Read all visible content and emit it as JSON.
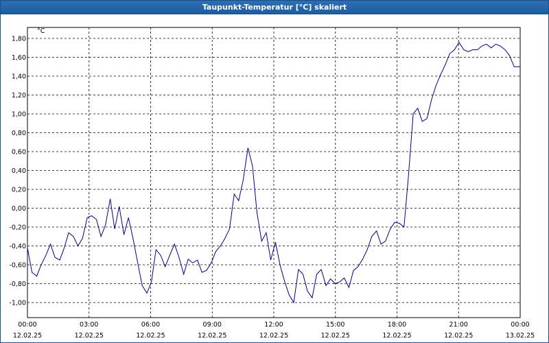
{
  "window": {
    "title": "Taupunkt-Temperatur [°C] skaliert"
  },
  "chart_data": {
    "type": "line",
    "title": "Taupunkt-Temperatur [°C] skaliert",
    "ylabel": "°C",
    "xlabel": "",
    "ylim": [
      -1.1,
      1.9
    ],
    "xlim": [
      "12.02.25 00:00",
      "13.02.25 00:00"
    ],
    "grid": true,
    "line_color": "#00008b",
    "grid_color": "#000000",
    "y_ticks": [
      "1,80",
      "1,60",
      "1,40",
      "1,20",
      "1,00",
      "0,80",
      "0,60",
      "0,40",
      "0,20",
      "0,00",
      "-0,20",
      "-0,40",
      "-0,60",
      "-0,80",
      "-1,00"
    ],
    "x_ticks": [
      {
        "time": "00:00",
        "date": "12.02.25"
      },
      {
        "time": "03:00",
        "date": "12.02.25"
      },
      {
        "time": "06:00",
        "date": "12.02.25"
      },
      {
        "time": "09:00",
        "date": "12.02.25"
      },
      {
        "time": "12:00",
        "date": "12.02.25"
      },
      {
        "time": "15:00",
        "date": "12.02.25"
      },
      {
        "time": "18:00",
        "date": "12.02.25"
      },
      {
        "time": "21:00",
        "date": "12.02.25"
      },
      {
        "time": "00:00",
        "date": "13.02.25"
      }
    ],
    "series": [
      {
        "x_hours": [
          0,
          0.22,
          0.45,
          0.67,
          0.9,
          1.12,
          1.34,
          1.57,
          1.79,
          2.01,
          2.24,
          2.46,
          2.68,
          2.91,
          3.13,
          3.36,
          3.58,
          3.8,
          4.03,
          4.25,
          4.47,
          4.7,
          4.92,
          5.14,
          5.37,
          5.59,
          5.82,
          6.04,
          6.26,
          6.49,
          6.71,
          6.93,
          7.16,
          7.38,
          7.61,
          7.83,
          8.05,
          8.28,
          8.5,
          8.72,
          8.95,
          9.17,
          9.4,
          9.62,
          9.84,
          10.07,
          10.29,
          10.51,
          10.74,
          10.96,
          11.18,
          11.41,
          11.63,
          11.85,
          12.08,
          12.3,
          12.53,
          12.75,
          12.97,
          13.2,
          13.42,
          13.64,
          13.87,
          14.09,
          14.31,
          14.54,
          14.76,
          14.98,
          15.21,
          15.43,
          15.66,
          15.88,
          16.1,
          16.33,
          16.55,
          16.77,
          17,
          17.22,
          17.44,
          17.67,
          17.89,
          18.12,
          18.34,
          18.56,
          18.79,
          19.01,
          19.23,
          19.46,
          19.68,
          19.9,
          20.13,
          20.35,
          20.57,
          20.8,
          21.02,
          21.25,
          21.47,
          21.69,
          21.92,
          22.14,
          22.36,
          22.59,
          22.81,
          23.03,
          23.26,
          23.48,
          23.71,
          24
        ],
        "y": [
          -0.42,
          -0.68,
          -0.72,
          -0.6,
          -0.5,
          -0.38,
          -0.52,
          -0.55,
          -0.42,
          -0.26,
          -0.3,
          -0.4,
          -0.32,
          -0.1,
          -0.08,
          -0.12,
          -0.3,
          -0.18,
          0.1,
          -0.22,
          0.02,
          -0.28,
          -0.1,
          -0.32,
          -0.58,
          -0.82,
          -0.9,
          -0.78,
          -0.44,
          -0.5,
          -0.62,
          -0.5,
          -0.38,
          -0.52,
          -0.7,
          -0.54,
          -0.58,
          -0.55,
          -0.68,
          -0.66,
          -0.58,
          -0.46,
          -0.4,
          -0.32,
          -0.22,
          0.15,
          0.08,
          0.3,
          0.64,
          0.45,
          -0.05,
          -0.35,
          -0.26,
          -0.55,
          -0.36,
          -0.6,
          -0.78,
          -0.92,
          -1.0,
          -0.65,
          -0.7,
          -0.88,
          -0.95,
          -0.7,
          -0.65,
          -0.82,
          -0.75,
          -0.8,
          -0.78,
          -0.74,
          -0.84,
          -0.66,
          -0.62,
          -0.54,
          -0.44,
          -0.3,
          -0.24,
          -0.38,
          -0.35,
          -0.22,
          -0.15,
          -0.16,
          -0.2,
          0.35,
          1.0,
          1.06,
          0.92,
          0.95,
          1.15,
          1.3,
          1.42,
          1.52,
          1.64,
          1.68,
          1.76,
          1.68,
          1.66,
          1.68,
          1.68,
          1.72,
          1.74,
          1.7,
          1.74,
          1.72,
          1.68,
          1.62,
          1.5,
          1.5
        ]
      }
    ]
  }
}
